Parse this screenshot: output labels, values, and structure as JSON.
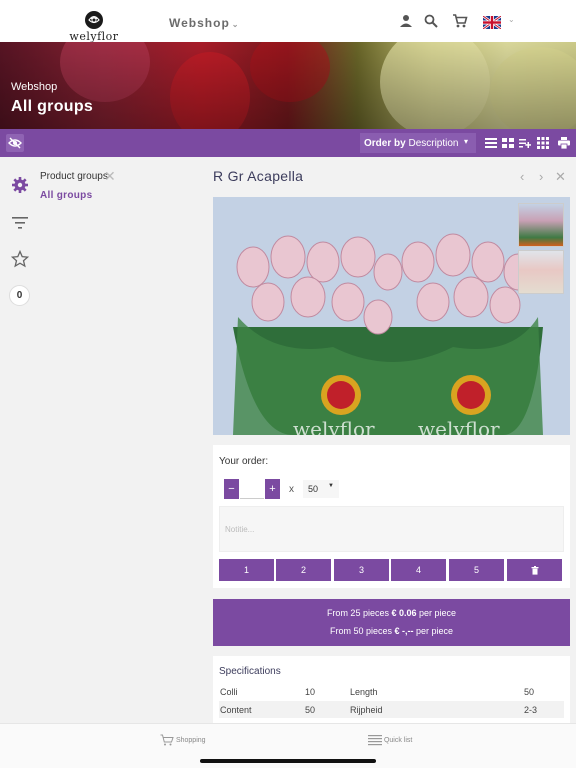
{
  "header": {
    "logo_text": "welyflor",
    "nav_label": "Webshop",
    "icons": [
      "person-icon",
      "search-icon",
      "cart-icon"
    ],
    "language_flag": "uk-flag"
  },
  "hero": {
    "breadcrumb": "Webshop",
    "title": "All groups"
  },
  "toolbar": {
    "order_prefix": "Order by",
    "order_value": "Description",
    "view_icons": [
      "list-icon",
      "grid-icon",
      "playlist-add-icon",
      "apps-icon",
      "print-icon"
    ]
  },
  "sidebar": {
    "badge_count": "0",
    "product_groups_title": "Product groups",
    "all_groups_link": "All groups"
  },
  "product": {
    "title": "R Gr Acapella",
    "photo_brand_text": "welyflor"
  },
  "order": {
    "label": "Your order:",
    "minus_label": "−",
    "plus_label": "+",
    "times_label": "x",
    "pack_size": "50",
    "note_placeholder": "Notitie...",
    "quick_buttons": [
      "1",
      "2",
      "3",
      "4",
      "5"
    ],
    "delete_icon": "trash-icon"
  },
  "pricing": {
    "line1_prefix": "From 25 pieces",
    "line1_price": "€ 0.06",
    "line1_suffix": "per piece",
    "line2_prefix": "From 50 pieces",
    "line2_price": "€ -,--",
    "line2_suffix": "per piece"
  },
  "specs": {
    "title": "Specifications",
    "rows": [
      {
        "k1": "Colli",
        "v1": "10",
        "k2": "Length",
        "v2": "50"
      },
      {
        "k1": "Content",
        "v1": "50",
        "k2": "Rijpheid",
        "v2": "2-3"
      }
    ]
  },
  "tabs": {
    "shopping": "Shopping",
    "quick_list": "Quick list"
  },
  "colors": {
    "accent": "#7b4aa1",
    "panel_bg": "#f2f2f2"
  }
}
